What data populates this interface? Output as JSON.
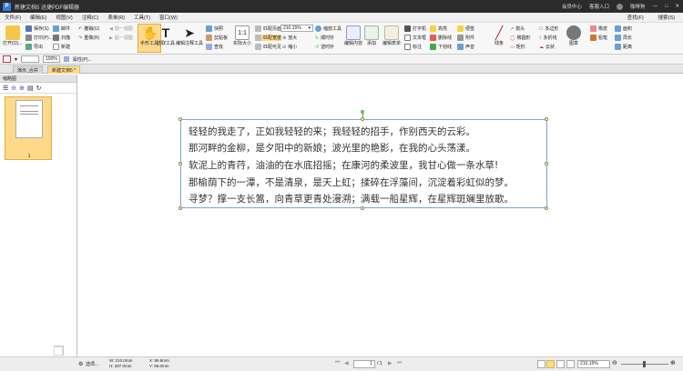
{
  "app": {
    "title": "新建文档5 迅捷PDF编辑器"
  },
  "titlebar": {
    "member": "会员中心",
    "login": "客服入口",
    "user": "咖啡狗"
  },
  "menu": [
    "文件(F)",
    "编辑(E)",
    "视图(V)",
    "注释(C)",
    "表单(R)",
    "工具(T)",
    "窗口(W)"
  ],
  "menu_right": [
    "查找(F)",
    "搜索(S)"
  ],
  "toolbar": {
    "open": "打开(O)...",
    "save": "保存(S)",
    "print": "打印(P)...",
    "export": "导出",
    "email": "邮件",
    "scan": "扫描",
    "new": "新建",
    "undo": "撤销(U)",
    "redo": "重做(R)",
    "prev": "前一视图",
    "next": "后一视图",
    "hand": "手形工具",
    "select": "选取工具",
    "edit": "编辑注释工具",
    "snapshot": "快照",
    "clipboard": "剪贴板",
    "find": "查找",
    "actual": "实际大小",
    "fit_page": "匹配页面",
    "fit_width": "匹配宽度",
    "fit_visible": "匹配可见",
    "zoom": "210.15%",
    "zoom_tool": "缩放工具",
    "zoom_in": "放大",
    "zoom_out": "缩小",
    "rotate_cw": "顺时针",
    "rotate_ccw": "逆时针",
    "typewriter": "打字机",
    "textbox": "文本框",
    "callout": "标注",
    "highlight": "高亮",
    "strike": "删除线",
    "underline": "下划线",
    "note": "便签",
    "attach": "附件",
    "sound": "声音",
    "line": "线条",
    "arrow": "箭头",
    "ellipse": "椭圆形",
    "rect": "矩形",
    "polygon": "多边形",
    "polyline": "多折线",
    "cloud": "云状",
    "stamp": "图章",
    "eraser": "橡皮",
    "pencil": "铅笔",
    "area": "面积",
    "perimeter": "周长",
    "distance": "距离",
    "edit_content": "编辑内容",
    "add": "添加",
    "edit_form": "编辑表单"
  },
  "format": {
    "zoom": "100%",
    "prop": "属性(P)..."
  },
  "tabs": [
    "演示_合并",
    "新建文档5 *"
  ],
  "sidebar": {
    "title": "缩略图",
    "page_label": "1"
  },
  "document": {
    "lines": [
      "轻轻的我走了，正如我轻轻的来；我轻轻的招手，作别西天的云彩。",
      "那河畔的金柳，是夕阳中的新娘；波光里的艳影，在我的心头荡漾。",
      "软泥上的青荇，油油的在水底招摇；在康河的柔波里，我甘心做一条水草!",
      "那榆荫下的一潭，不是清泉，是天上虹；揉碎在浮藻间，沉淀着彩虹似的梦。",
      "寻梦？撑一支长篙，向青草更青处漫溯；满载一船星辉，在星辉斑斓里放歌。"
    ]
  },
  "status": {
    "options": "选项...",
    "w": "W: 210.0mm",
    "h": "H: 297.0mm",
    "x": "X: 89.8mm",
    "y": "Y: 69.0mm",
    "page": "1",
    "pages": "/ 1",
    "zoom": "210.15%"
  },
  "colors": {
    "accent": "#ffd98a",
    "titlebar": "#2b2b2b",
    "selection": "#7aaaca"
  }
}
